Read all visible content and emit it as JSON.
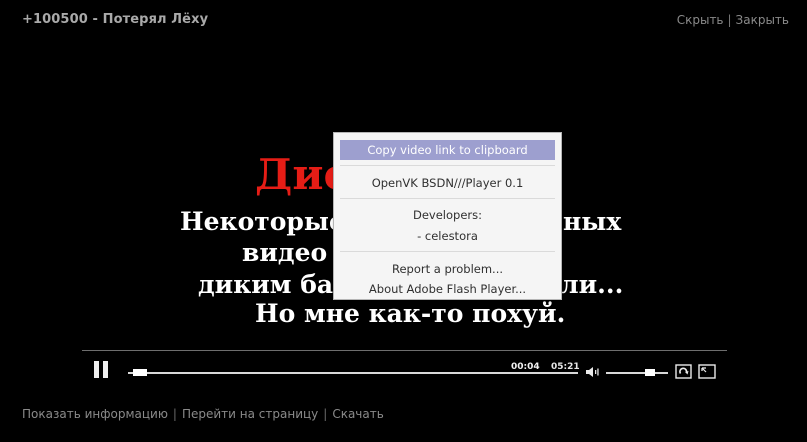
{
  "window": {
    "title": "+100500 - Потерял Лёху",
    "links": [
      "Скрыть",
      "Закрыть"
    ],
    "link_separator": "|"
  },
  "video_frame": {
    "red_text": "Дис",
    "lines": [
      "Некоторые ... ных",
      "видео",
      "диким ба... ли...",
      "Но мне как-то похуй."
    ],
    "line_fragments": [
      {
        "left": "Некоторые",
        "right": "ных"
      },
      {
        "left": "видео",
        "right": ""
      },
      {
        "left": "диким ба",
        "right": "ли..."
      },
      {
        "left": "Но мне как-то похуй.",
        "right": ""
      }
    ]
  },
  "player": {
    "current_time": "00:04",
    "total_time": "05:21",
    "progress_fraction": 0.012,
    "volume_fraction": 0.75,
    "state": "playing",
    "icons": {
      "pause": "pause-icon",
      "volume": "volume-icon",
      "loop": "loop-icon",
      "fullscreen": "fullscreen-icon"
    }
  },
  "context_menu": {
    "items": [
      {
        "label": "Copy video link to clipboard",
        "highlighted": true
      },
      {
        "label": "OpenVK BSDN///Player 0.1"
      },
      {
        "label": "Developers:"
      },
      {
        "label": "- celestora"
      },
      {
        "label": "Report a problem..."
      },
      {
        "label": "About Adobe Flash Player..."
      }
    ],
    "highlight_color": "#9d9fcf"
  },
  "footer": {
    "links": [
      "Показать информацию",
      "Перейти на страницу",
      "Скачать"
    ],
    "separator": "|"
  }
}
